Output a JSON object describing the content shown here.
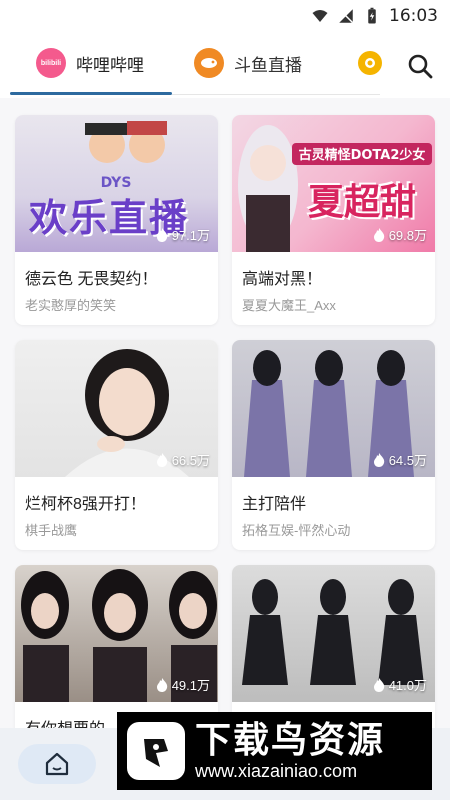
{
  "status_bar": {
    "time": "16:03"
  },
  "tabs": [
    {
      "label": "哔哩哔哩",
      "active": true,
      "logo_text": "bilibili",
      "logo_color": "#f45a8d"
    },
    {
      "label": "斗鱼直播",
      "active": false,
      "logo_text": "",
      "logo_color": "#f08a24"
    }
  ],
  "cards": [
    {
      "title": "德云色 无畏契约！",
      "streamer": "老实憨厚的笑笑",
      "viewers": "97.1万",
      "thumb_text": "欢乐直播",
      "thumb_tag": "DYS"
    },
    {
      "title": "高端对黑！",
      "streamer": "夏夏大魔王_Axx",
      "viewers": "69.8万",
      "thumb_text": "夏超甜",
      "thumb_tag": "古灵精怪DOTA2少女"
    },
    {
      "title": "烂柯杯8强开打！",
      "streamer": "棋手战鹰",
      "viewers": "66.5万"
    },
    {
      "title": "主打陪伴",
      "streamer": "拓格互娱-怦然心动",
      "viewers": "64.5万"
    },
    {
      "title": "有你想要的",
      "streamer": "",
      "viewers": "49.1万"
    },
    {
      "title": "",
      "streamer": "",
      "viewers": "41.0万"
    }
  ],
  "watermark": {
    "title": "下载鸟资源",
    "url": "www.xiazainiao.com"
  },
  "colors": {
    "accent": "#2d6a9f",
    "background": "#f7f7f9"
  }
}
